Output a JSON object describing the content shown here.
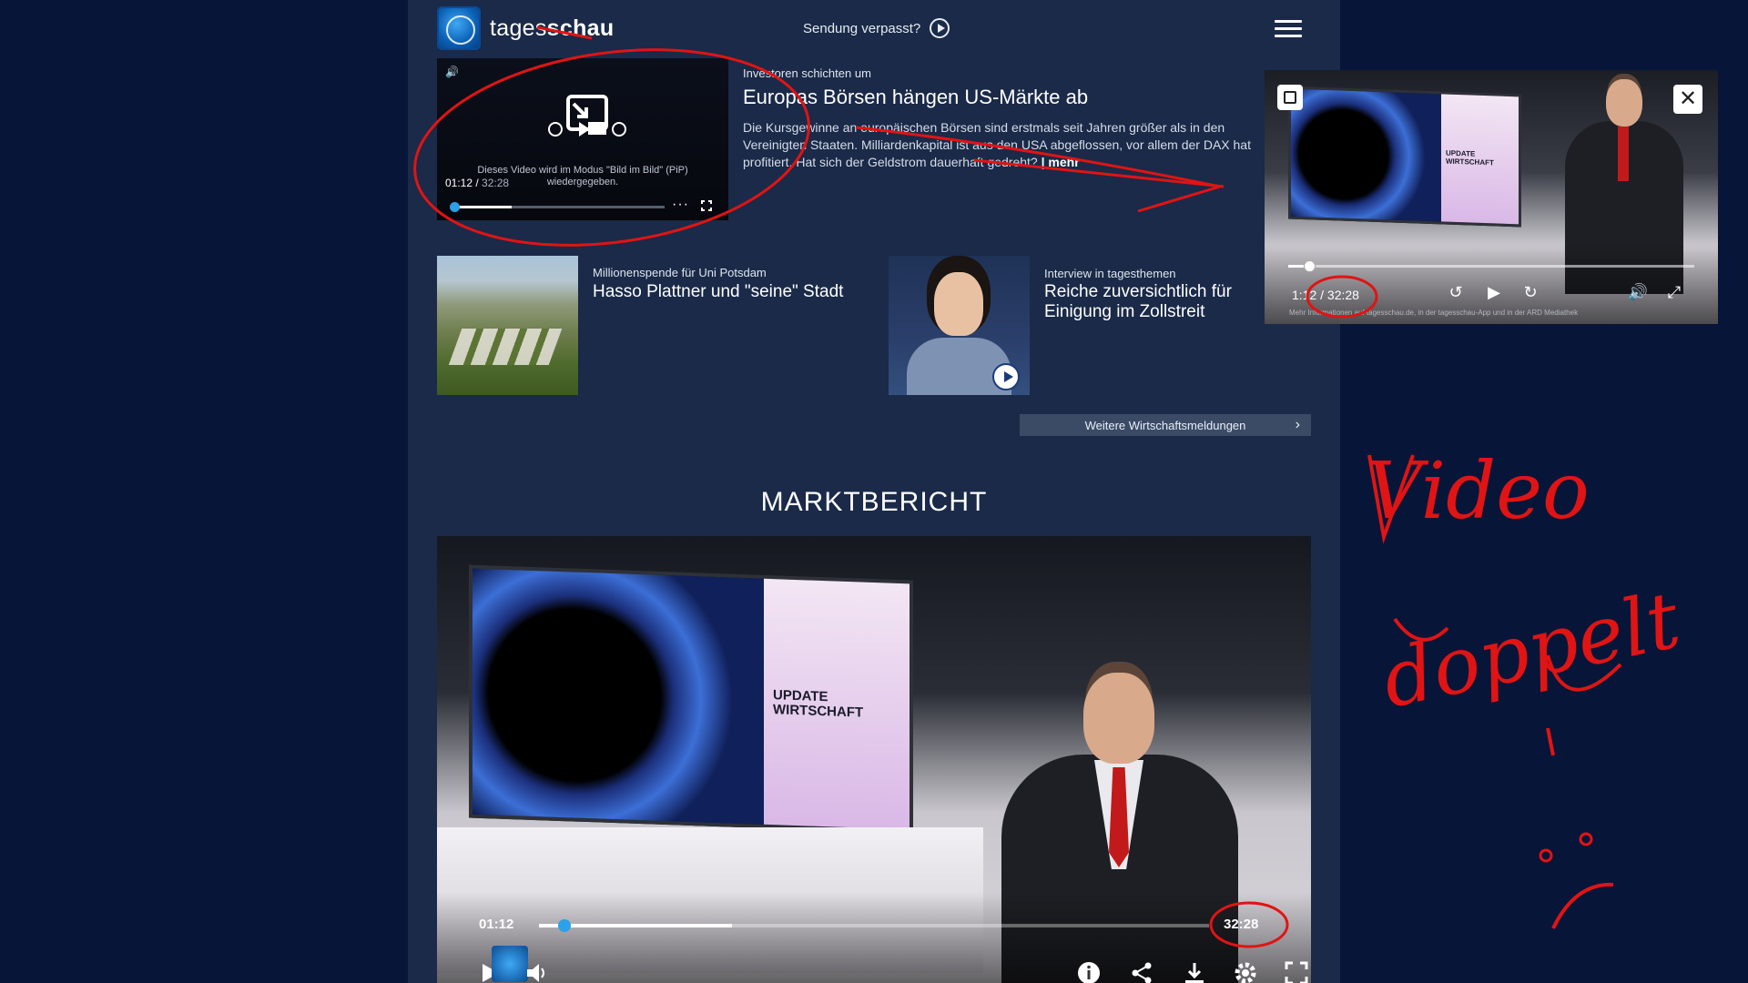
{
  "header": {
    "logo_text_light": "tages",
    "logo_text_bold": "schau",
    "missed_label": "Sendung verpasst?"
  },
  "pip_player": {
    "message": "Dieses Video wird im Modus \"Bild im Bild\" (PiP) wiedergegeben.",
    "current_time": "01:12",
    "duration": "32:28",
    "progress": 0.037
  },
  "lead": {
    "kicker": "Investoren schichten um",
    "title": "Europas Börsen hängen US-Märkte ab",
    "text": "Die Kursgewinne an europäischen Börsen sind erstmals seit Jahren größer als in den Vereinigten Staaten. Milliardenkapital ist aus den USA abgeflossen, vor allem der DAX hat profitiert. Hat sich der Geldstrom dauerhaft gedreht?",
    "more": "| mehr"
  },
  "teasers": [
    {
      "kicker": "Millionenspende für Uni Potsdam",
      "title": "Hasso Plattner und \"seine\" Stadt"
    },
    {
      "kicker": "Interview in tagesthemen",
      "title": "Reiche zuversichtlich für Einigung im Zollstreit"
    }
  ],
  "more_button": "Weitere Wirtschaftsmeldungen",
  "section_title": "MARKTBERICHT",
  "main_player": {
    "screen_text_1": "UPDATE",
    "screen_text_2": "WIRTSCHAFT",
    "current_time": "01:12",
    "duration": "32:28",
    "progress": 0.037
  },
  "pip_window": {
    "screen_text_1": "UPDATE",
    "screen_text_2": "WIRTSCHAFT",
    "time_display": "1:12 / 32:28",
    "footer": "Mehr Informationen auf tagesschau.de, in der tagesschau-App und in der ARD Mediathek",
    "progress": 0.037
  },
  "annotation": {
    "line1": "Video",
    "line2": "doppelt",
    "line3": ":-("
  },
  "colors": {
    "background": "#071538",
    "page": "#1a2a48",
    "accent": "#2aa1e8",
    "annotation": "#e01414"
  }
}
